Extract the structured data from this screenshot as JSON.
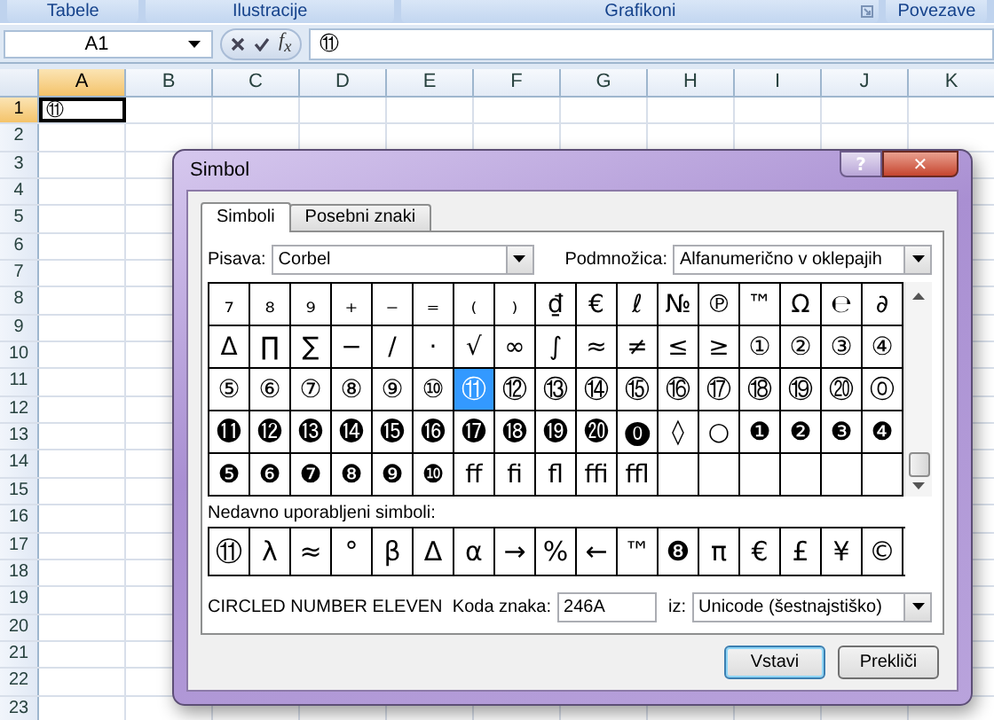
{
  "ribbon_groups": [
    {
      "label": "Tabele",
      "launcher": false
    },
    {
      "label": "Ilustracije",
      "launcher": false
    },
    {
      "label": "Grafikoni",
      "launcher": true
    },
    {
      "label": "Povezave",
      "launcher": false
    }
  ],
  "formula_bar": {
    "name_box": "A1",
    "function_label": "f$_{x}$",
    "content": "⑪"
  },
  "columns": [
    {
      "label": "A",
      "selected": true
    },
    {
      "label": "B",
      "selected": false
    },
    {
      "label": "C",
      "selected": false
    },
    {
      "label": "D",
      "selected": false
    },
    {
      "label": "E",
      "selected": false
    },
    {
      "label": "F",
      "selected": false
    },
    {
      "label": "G",
      "selected": false
    },
    {
      "label": "H",
      "selected": false
    },
    {
      "label": "I",
      "selected": false
    },
    {
      "label": "J",
      "selected": false
    },
    {
      "label": "K",
      "selected": false
    }
  ],
  "rows": [
    {
      "label": "1",
      "selected": true,
      "cells": [
        {
          "value": "⑪",
          "selected": true
        }
      ]
    },
    {
      "label": "2",
      "selected": false
    },
    {
      "label": "3",
      "selected": false
    },
    {
      "label": "4",
      "selected": false
    },
    {
      "label": "5",
      "selected": false
    },
    {
      "label": "6",
      "selected": false
    },
    {
      "label": "7",
      "selected": false
    },
    {
      "label": "8",
      "selected": false
    },
    {
      "label": "9",
      "selected": false
    },
    {
      "label": "10",
      "selected": false
    },
    {
      "label": "11",
      "selected": false
    },
    {
      "label": "12",
      "selected": false
    },
    {
      "label": "13",
      "selected": false
    },
    {
      "label": "14",
      "selected": false
    },
    {
      "label": "15",
      "selected": false
    },
    {
      "label": "16",
      "selected": false
    },
    {
      "label": "17",
      "selected": false
    },
    {
      "label": "18",
      "selected": false
    },
    {
      "label": "19",
      "selected": false
    },
    {
      "label": "20",
      "selected": false
    },
    {
      "label": "21",
      "selected": false
    },
    {
      "label": "22",
      "selected": false
    },
    {
      "label": "23",
      "selected": false
    }
  ],
  "dialog": {
    "title": "Simbol",
    "help_button": "?",
    "close_button": "✕",
    "tabs": [
      {
        "label": "Simboli",
        "selected": true
      },
      {
        "label": "Posebni znaki",
        "selected": false
      }
    ],
    "font": {
      "label": "Pisava:",
      "value": "Corbel"
    },
    "subset": {
      "label": "Podmnožica:",
      "value": "Alfanumerično v oklepajih"
    },
    "symbols": [
      {
        "char": "₇",
        "selected": false
      },
      {
        "char": "₈",
        "selected": false
      },
      {
        "char": "₉",
        "selected": false
      },
      {
        "char": "₊",
        "selected": false
      },
      {
        "char": "₋",
        "selected": false
      },
      {
        "char": "₌",
        "selected": false
      },
      {
        "char": "₍",
        "selected": false
      },
      {
        "char": "₎",
        "selected": false
      },
      {
        "char": "₫",
        "selected": false
      },
      {
        "char": "€",
        "selected": false
      },
      {
        "char": "ℓ",
        "selected": false
      },
      {
        "char": "№",
        "selected": false
      },
      {
        "char": "℗",
        "selected": false
      },
      {
        "char": "™",
        "selected": false
      },
      {
        "char": "Ω",
        "selected": false
      },
      {
        "char": "℮",
        "selected": false
      },
      {
        "char": "∂",
        "selected": false
      },
      {
        "char": "Δ",
        "selected": false
      },
      {
        "char": "∏",
        "selected": false
      },
      {
        "char": "∑",
        "selected": false
      },
      {
        "char": "−",
        "selected": false
      },
      {
        "char": "∕",
        "selected": false
      },
      {
        "char": "·",
        "selected": false
      },
      {
        "char": "√",
        "selected": false
      },
      {
        "char": "∞",
        "selected": false
      },
      {
        "char": "∫",
        "selected": false
      },
      {
        "char": "≈",
        "selected": false
      },
      {
        "char": "≠",
        "selected": false
      },
      {
        "char": "≤",
        "selected": false
      },
      {
        "char": "≥",
        "selected": false
      },
      {
        "char": "①",
        "selected": false
      },
      {
        "char": "②",
        "selected": false
      },
      {
        "char": "③",
        "selected": false
      },
      {
        "char": "④",
        "selected": false
      },
      {
        "char": "⑤",
        "selected": false
      },
      {
        "char": "⑥",
        "selected": false
      },
      {
        "char": "⑦",
        "selected": false
      },
      {
        "char": "⑧",
        "selected": false
      },
      {
        "char": "⑨",
        "selected": false
      },
      {
        "char": "⑩",
        "selected": false
      },
      {
        "char": "⑪",
        "selected": true
      },
      {
        "char": "⑫",
        "selected": false
      },
      {
        "char": "⑬",
        "selected": false
      },
      {
        "char": "⑭",
        "selected": false
      },
      {
        "char": "⑮",
        "selected": false
      },
      {
        "char": "⑯",
        "selected": false
      },
      {
        "char": "⑰",
        "selected": false
      },
      {
        "char": "⑱",
        "selected": false
      },
      {
        "char": "⑲",
        "selected": false
      },
      {
        "char": "⑳",
        "selected": false
      },
      {
        "char": "⓪",
        "selected": false
      },
      {
        "char": "⓫",
        "selected": false
      },
      {
        "char": "⓬",
        "selected": false
      },
      {
        "char": "⓭",
        "selected": false
      },
      {
        "char": "⓮",
        "selected": false
      },
      {
        "char": "⓯",
        "selected": false
      },
      {
        "char": "⓰",
        "selected": false
      },
      {
        "char": "⓱",
        "selected": false
      },
      {
        "char": "⓲",
        "selected": false
      },
      {
        "char": "⓳",
        "selected": false
      },
      {
        "char": "⓴",
        "selected": false
      },
      {
        "char": "⓿",
        "selected": false
      },
      {
        "char": "◊",
        "selected": false
      },
      {
        "char": "○",
        "selected": false
      },
      {
        "char": "❶",
        "selected": false
      },
      {
        "char": "❷",
        "selected": false
      },
      {
        "char": "❸",
        "selected": false
      },
      {
        "char": "❹",
        "selected": false
      },
      {
        "char": "❺",
        "selected": false
      },
      {
        "char": "❻",
        "selected": false
      },
      {
        "char": "❼",
        "selected": false
      },
      {
        "char": "❽",
        "selected": false
      },
      {
        "char": "❾",
        "selected": false
      },
      {
        "char": "❿",
        "selected": false
      },
      {
        "char": "ﬀ",
        "selected": false
      },
      {
        "char": "ﬁ",
        "selected": false
      },
      {
        "char": "ﬂ",
        "selected": false
      },
      {
        "char": "ﬃ",
        "selected": false
      },
      {
        "char": "ﬄ",
        "selected": false
      }
    ],
    "recent_label": "Nedavno uporabljeni simboli:",
    "recent": [
      "⑪",
      "λ",
      "≈",
      "°",
      "β",
      "Δ",
      "α",
      "→",
      "%",
      "←",
      "™",
      "❽",
      "π",
      "€",
      "£",
      "¥",
      "©"
    ],
    "char_name": "CIRCLED NUMBER ELEVEN",
    "char_code": {
      "label": "Koda znaka:",
      "value": "246A"
    },
    "from": {
      "label": "iz:",
      "value": "Unicode (šestnajstiško)"
    },
    "buttons": [
      {
        "label": "Vstavi",
        "default": true
      },
      {
        "label": "Prekliči",
        "default": false
      }
    ]
  }
}
